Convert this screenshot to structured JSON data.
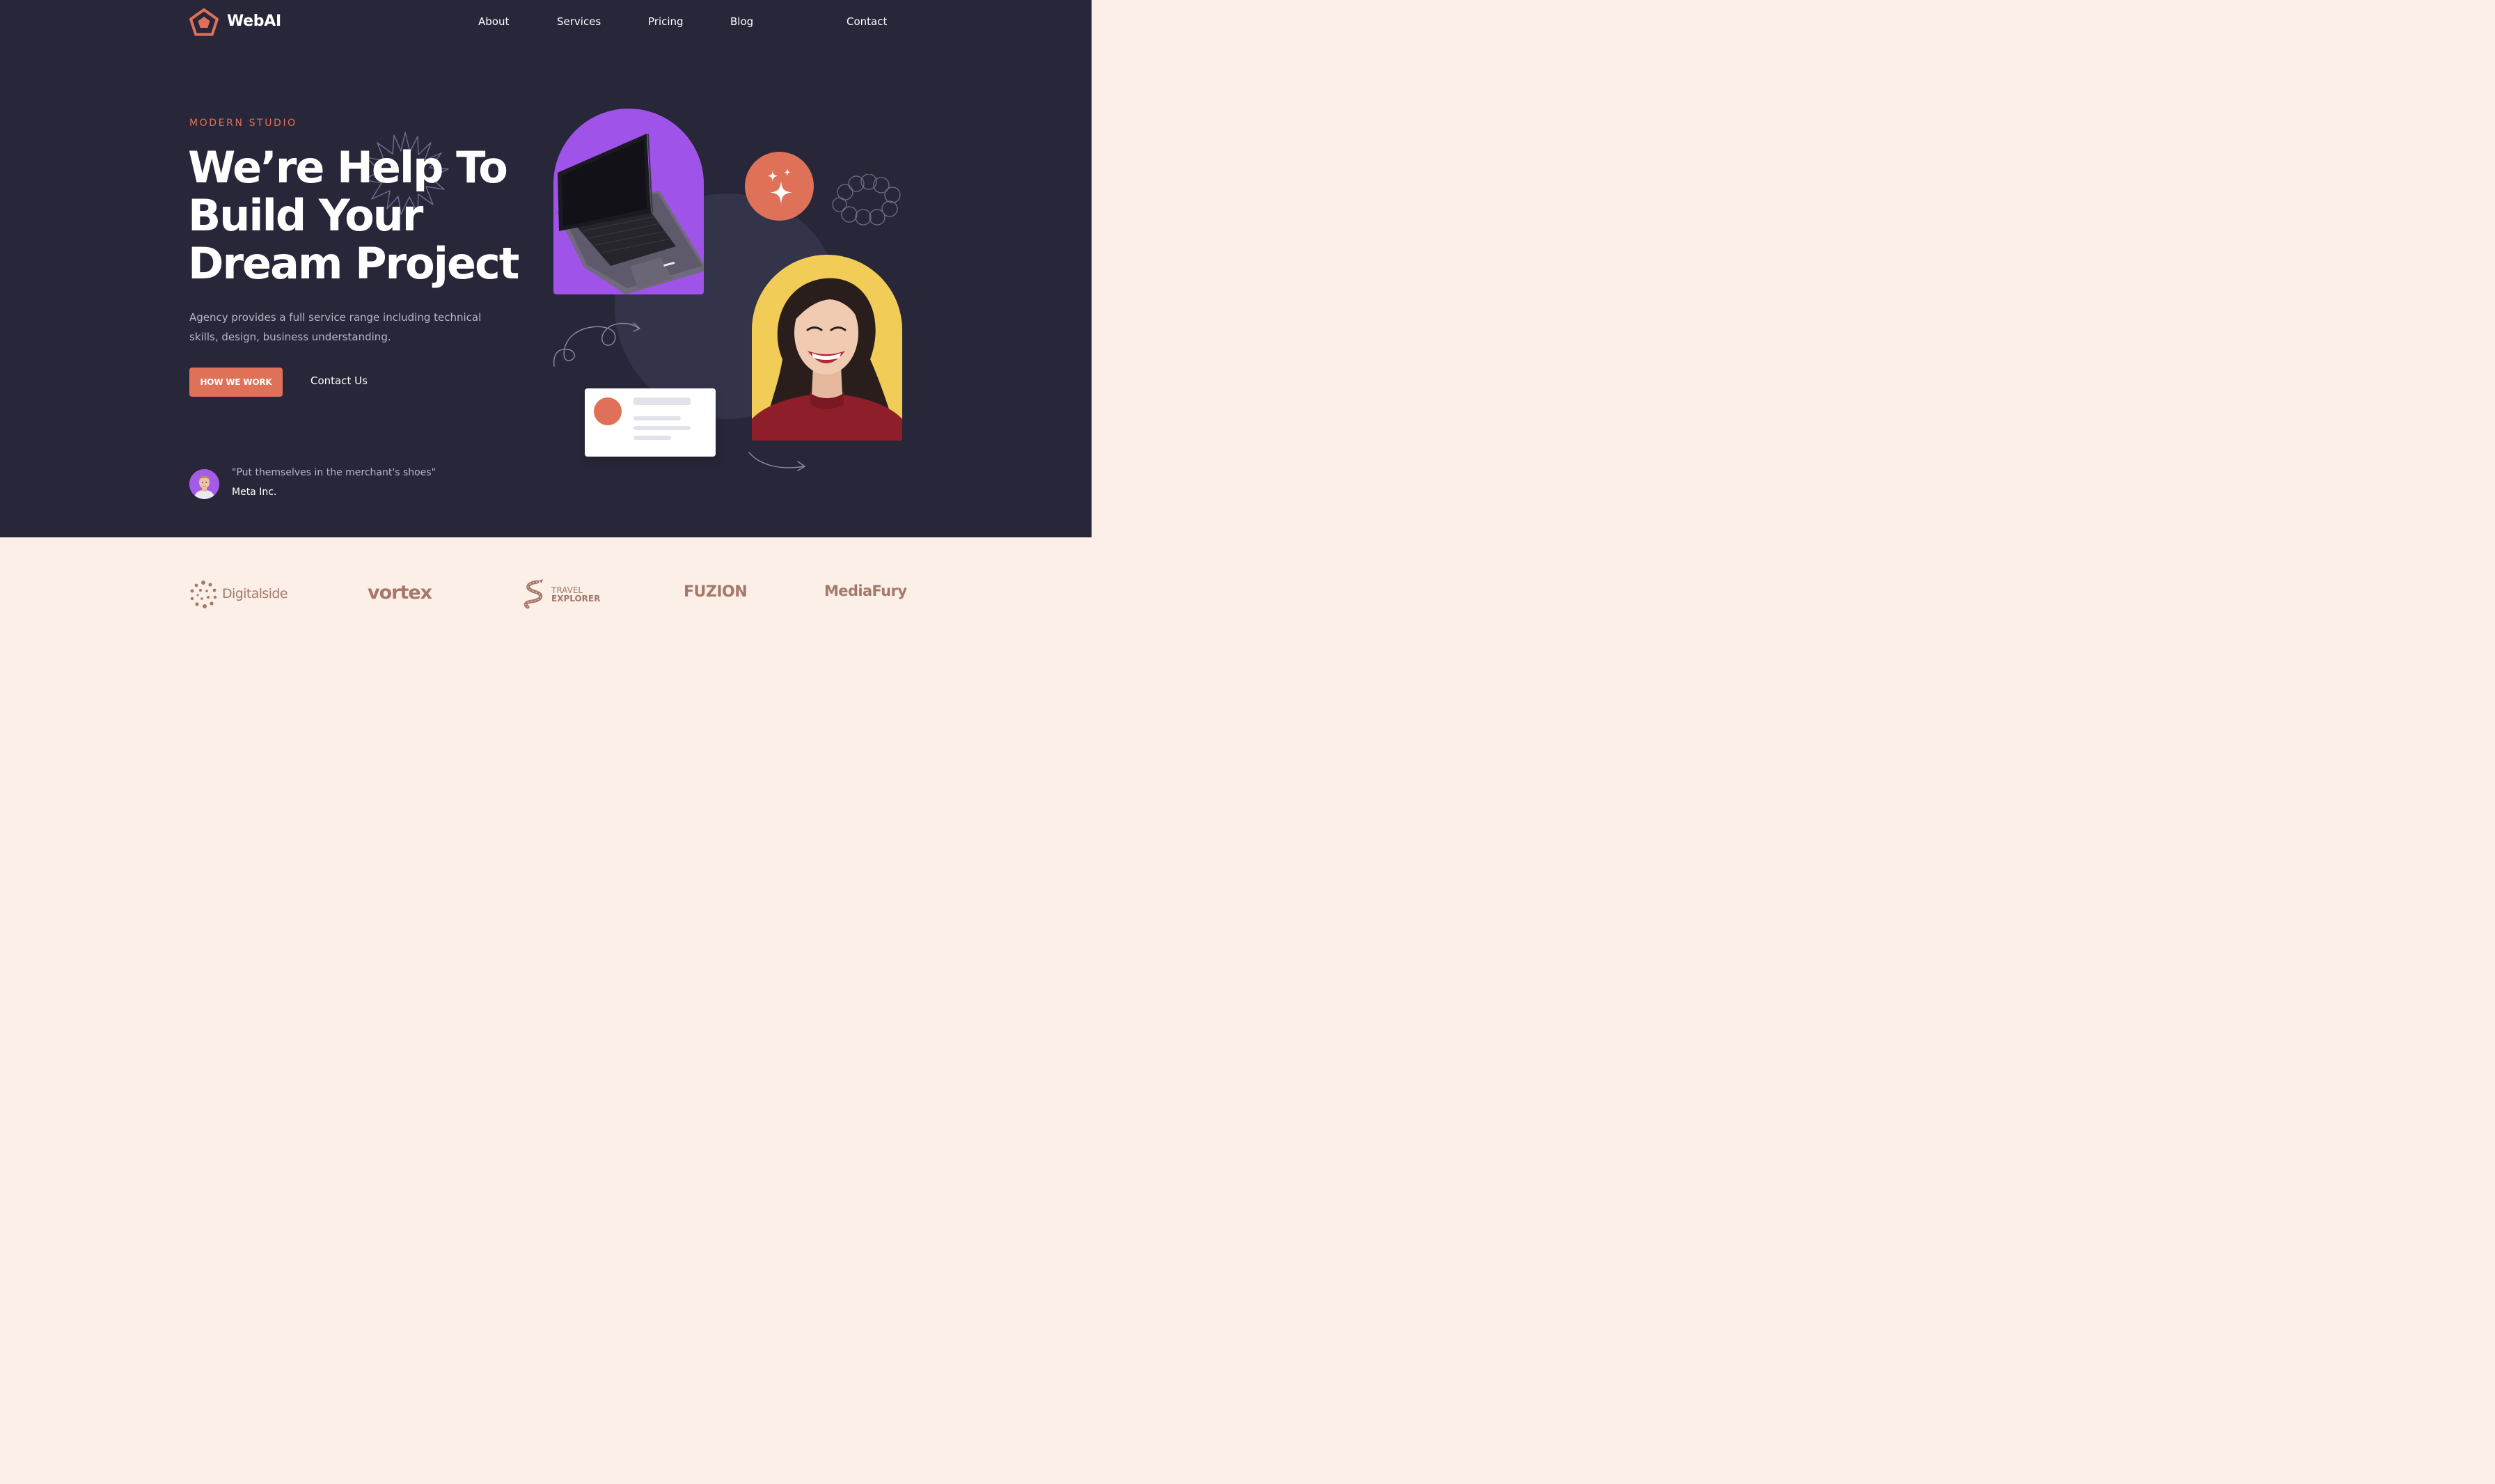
{
  "brand": {
    "name": "WebAI",
    "icon": "pentagon-logo-icon",
    "accent": "#E07159"
  },
  "nav": [
    {
      "label": "About"
    },
    {
      "label": "Services"
    },
    {
      "label": "Pricing"
    },
    {
      "label": "Blog"
    },
    {
      "label": "Contact"
    }
  ],
  "hero": {
    "eyebrow": "MODERN STUDIO",
    "headline_lines": [
      "We’re Help To",
      "Build Your",
      "Dream Project"
    ],
    "description": "Agency provides a full service range including technical skills, design, business understanding.",
    "primary_button": "HOW WE WORK",
    "secondary_button": "Contact Us"
  },
  "testimonial": {
    "quote": "\"Put themselves in the merchant's shoes\"",
    "company": "Meta Inc."
  },
  "partners": [
    {
      "name": "Digitalside",
      "icon": "dots-ring-icon"
    },
    {
      "name": "vortex",
      "icon": "swirl-o-icon"
    },
    {
      "name_top": "TRAVEL",
      "name_bottom": "EXPLORER",
      "icon": "road-icon"
    },
    {
      "name": "FUZION"
    },
    {
      "name": "MediaFury"
    }
  ],
  "colors": {
    "hero_bg": "#272739",
    "accent": "#E07159",
    "purple": "#A053E9",
    "yellow": "#F1CD58",
    "band_bg": "#FBEFE8",
    "partner_text": "#A6786A"
  }
}
